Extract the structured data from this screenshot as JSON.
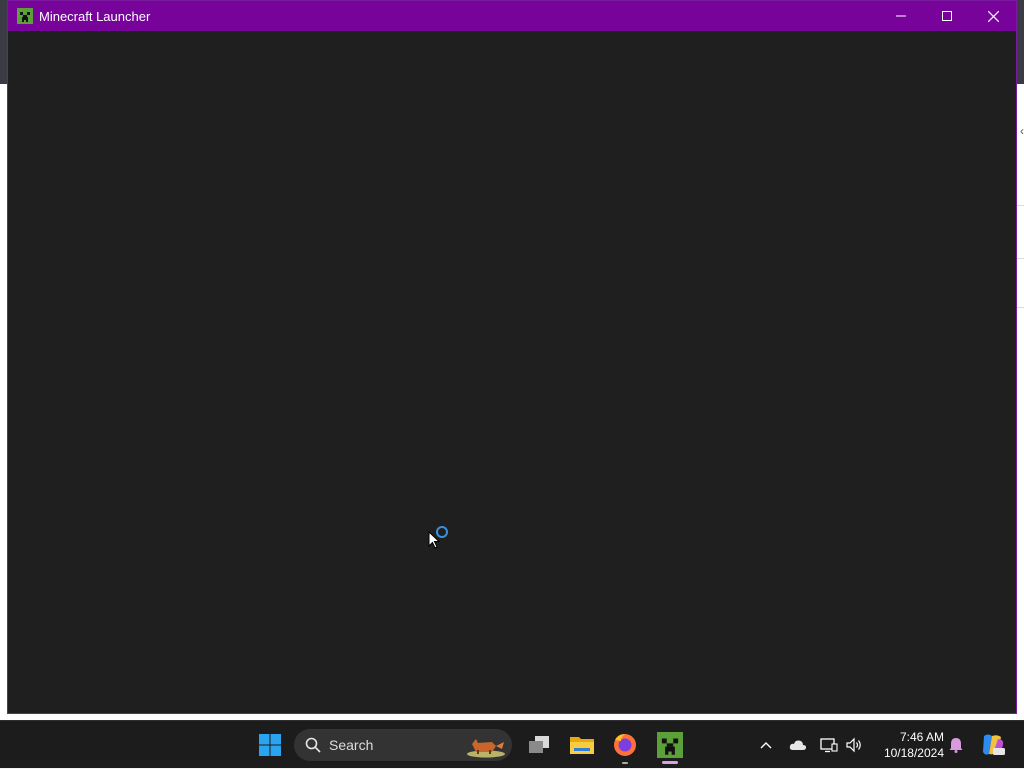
{
  "window": {
    "title": "Minecraft Launcher",
    "icon": "creeper-icon",
    "controls": [
      "minimize-icon",
      "maximize-icon",
      "close-icon"
    ],
    "state": "loading"
  },
  "taskbar": {
    "search_label": "Search",
    "apps": [
      "windows-start-icon",
      "task-view-icon",
      "file-explorer-icon",
      "firefox-icon",
      "minecraft-launcher-icon"
    ],
    "tray_icons": [
      "chevron-up-icon",
      "onedrive-cloud-icon",
      "network-icon",
      "volume-icon",
      "notification-bell-icon",
      "copilot-icon"
    ],
    "time": "7:46 AM",
    "date": "10/18/2024"
  },
  "colors": {
    "titlebar": "#77039b",
    "window_bg": "#1f1f1f",
    "spinner": "#3b8fe0",
    "taskbar": "#1c1c1c"
  }
}
